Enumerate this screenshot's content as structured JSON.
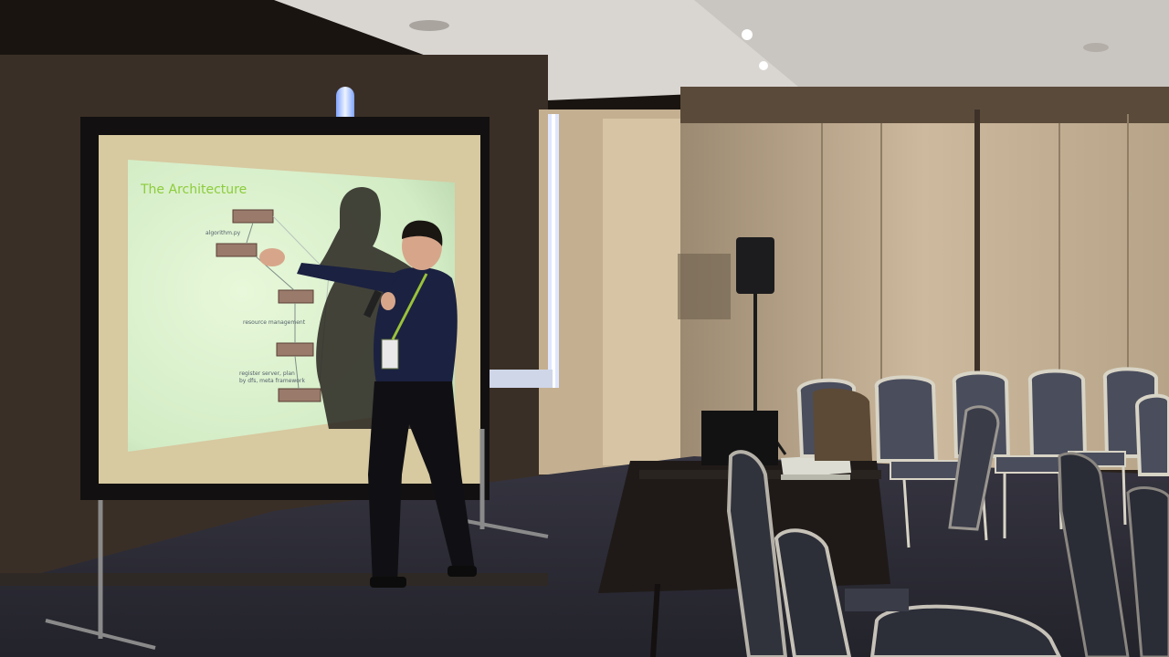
{
  "slide": {
    "title": "The Architecture",
    "labels": [
      "algorithm.py",
      "resource management",
      "register server, plan",
      "by dfs, meta framework"
    ]
  },
  "colors": {
    "screen": "#e6f6d3",
    "slide_title": "#8ccc3a",
    "wall": "#c8b59a",
    "carpet": "#2a2a33",
    "chair_frame": "#d8d4c6",
    "chair_seat": "#4a4d5c"
  }
}
